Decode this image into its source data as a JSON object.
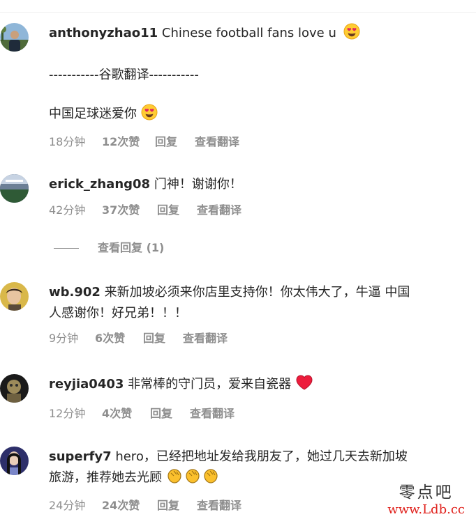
{
  "comments": [
    {
      "username": "anthonyzhao11",
      "text": "Chinese football fans love u",
      "translate_divider": "-----------谷歌翻译-----------",
      "translated_text": "中国足球迷爱你",
      "time": "18分钟",
      "likes": "12次赞",
      "reply": "回复",
      "translate": "查看翻译",
      "emoji": "heart-eyes-emoji"
    },
    {
      "username": "erick_zhang08",
      "text": "门神！谢谢你！",
      "time": "42分钟",
      "likes": "37次赞",
      "reply": "回复",
      "translate": "查看翻译"
    },
    {
      "username": "wb.902",
      "text_line1": "来新加坡必须来你店里支持你！你太伟大了，牛逼 中国",
      "text_line2": "人感谢你！好兄弟！！！",
      "time": "9分钟",
      "likes": "6次赞",
      "reply": "回复",
      "translate": "查看翻译"
    },
    {
      "username": "reyjia0403",
      "text": "非常棒的守门员，爱来自瓷器",
      "time": "12分钟",
      "likes": "4次赞",
      "reply": "回复",
      "translate": "查看翻译",
      "emoji": "red-heart-emoji"
    },
    {
      "username": "superfy7",
      "text_line1": "hero，已经把地址发给我朋友了，她过几天去新加坡",
      "text_line2": "旅游，推荐她去光顾",
      "time": "24分钟",
      "likes": "24次赞",
      "reply": "回复",
      "translate": "查看翻译",
      "emoji": "clapping-hands-emoji"
    }
  ],
  "view_replies": "查看回复 (1)",
  "watermark": {
    "name": "零点吧",
    "url": "www.Ldb.cc"
  },
  "colors": {
    "text": "#262626",
    "meta": "#8e8e8e",
    "heart": "#ed1c3c",
    "watermark_url": "#e0211c"
  }
}
